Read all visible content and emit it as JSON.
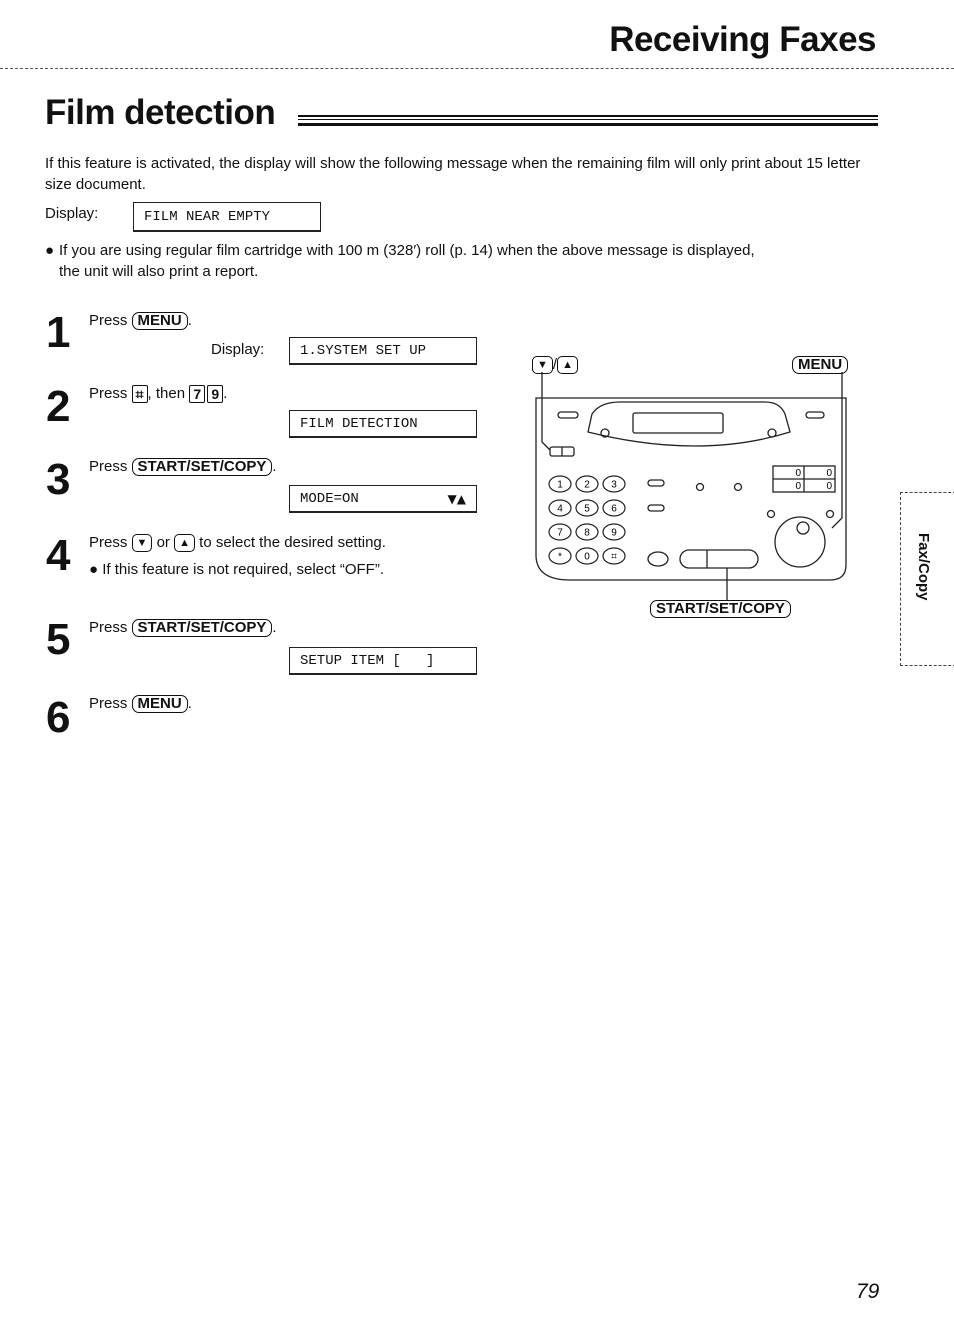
{
  "header": {
    "section": "Receiving Faxes"
  },
  "title": "Film detection",
  "intro": {
    "paragraph": "If this feature is activated, the display will show the following message when the remaining film will only print about 15 letter size document.",
    "display_label": "Display:",
    "display_value": "FILM NEAR EMPTY",
    "bullet_line1": "If you are using regular film cartridge with 100 m (328′) roll (p. 14) when the above message is displayed,",
    "bullet_line2": "the unit will also print a report."
  },
  "steps": [
    {
      "number": "1",
      "press": "Press",
      "key": "MENU",
      "suffix": ".",
      "display_label": "Display:",
      "display": "1.SYSTEM SET UP"
    },
    {
      "number": "2",
      "press": "Press",
      "key1": "⌗",
      "mid": ", then",
      "key2": "7",
      "key3": "9",
      "suffix": ".",
      "display": "FILM DETECTION"
    },
    {
      "number": "3",
      "press": "Press",
      "key": "START/SET/COPY",
      "suffix": ".",
      "display": "MODE=ON",
      "display_arrows": "▼▲"
    },
    {
      "number": "4",
      "press": "Press",
      "key1": "▼",
      "mid": "or",
      "key2": "▲",
      "rest": "to select the desired setting.",
      "bullet": "If this feature is not required, select “OFF”."
    },
    {
      "number": "5",
      "press": "Press",
      "key": "START/SET/COPY",
      "suffix": ".",
      "display": "SETUP ITEM [   ]"
    },
    {
      "number": "6",
      "press": "Press",
      "key": "MENU",
      "suffix": "."
    }
  ],
  "diagram": {
    "down_key": "▼",
    "slash": "/",
    "up_key": "▲",
    "menu_label": "MENU",
    "start_label": "START/SET/COPY",
    "keypad": [
      "1",
      "2",
      "3",
      "4",
      "5",
      "6",
      "7",
      "8",
      "9",
      "*",
      "0",
      "⌗"
    ],
    "counter": [
      "0",
      "0",
      "0",
      "0"
    ]
  },
  "side_tab": "Fax/Copy",
  "page_number": "79"
}
